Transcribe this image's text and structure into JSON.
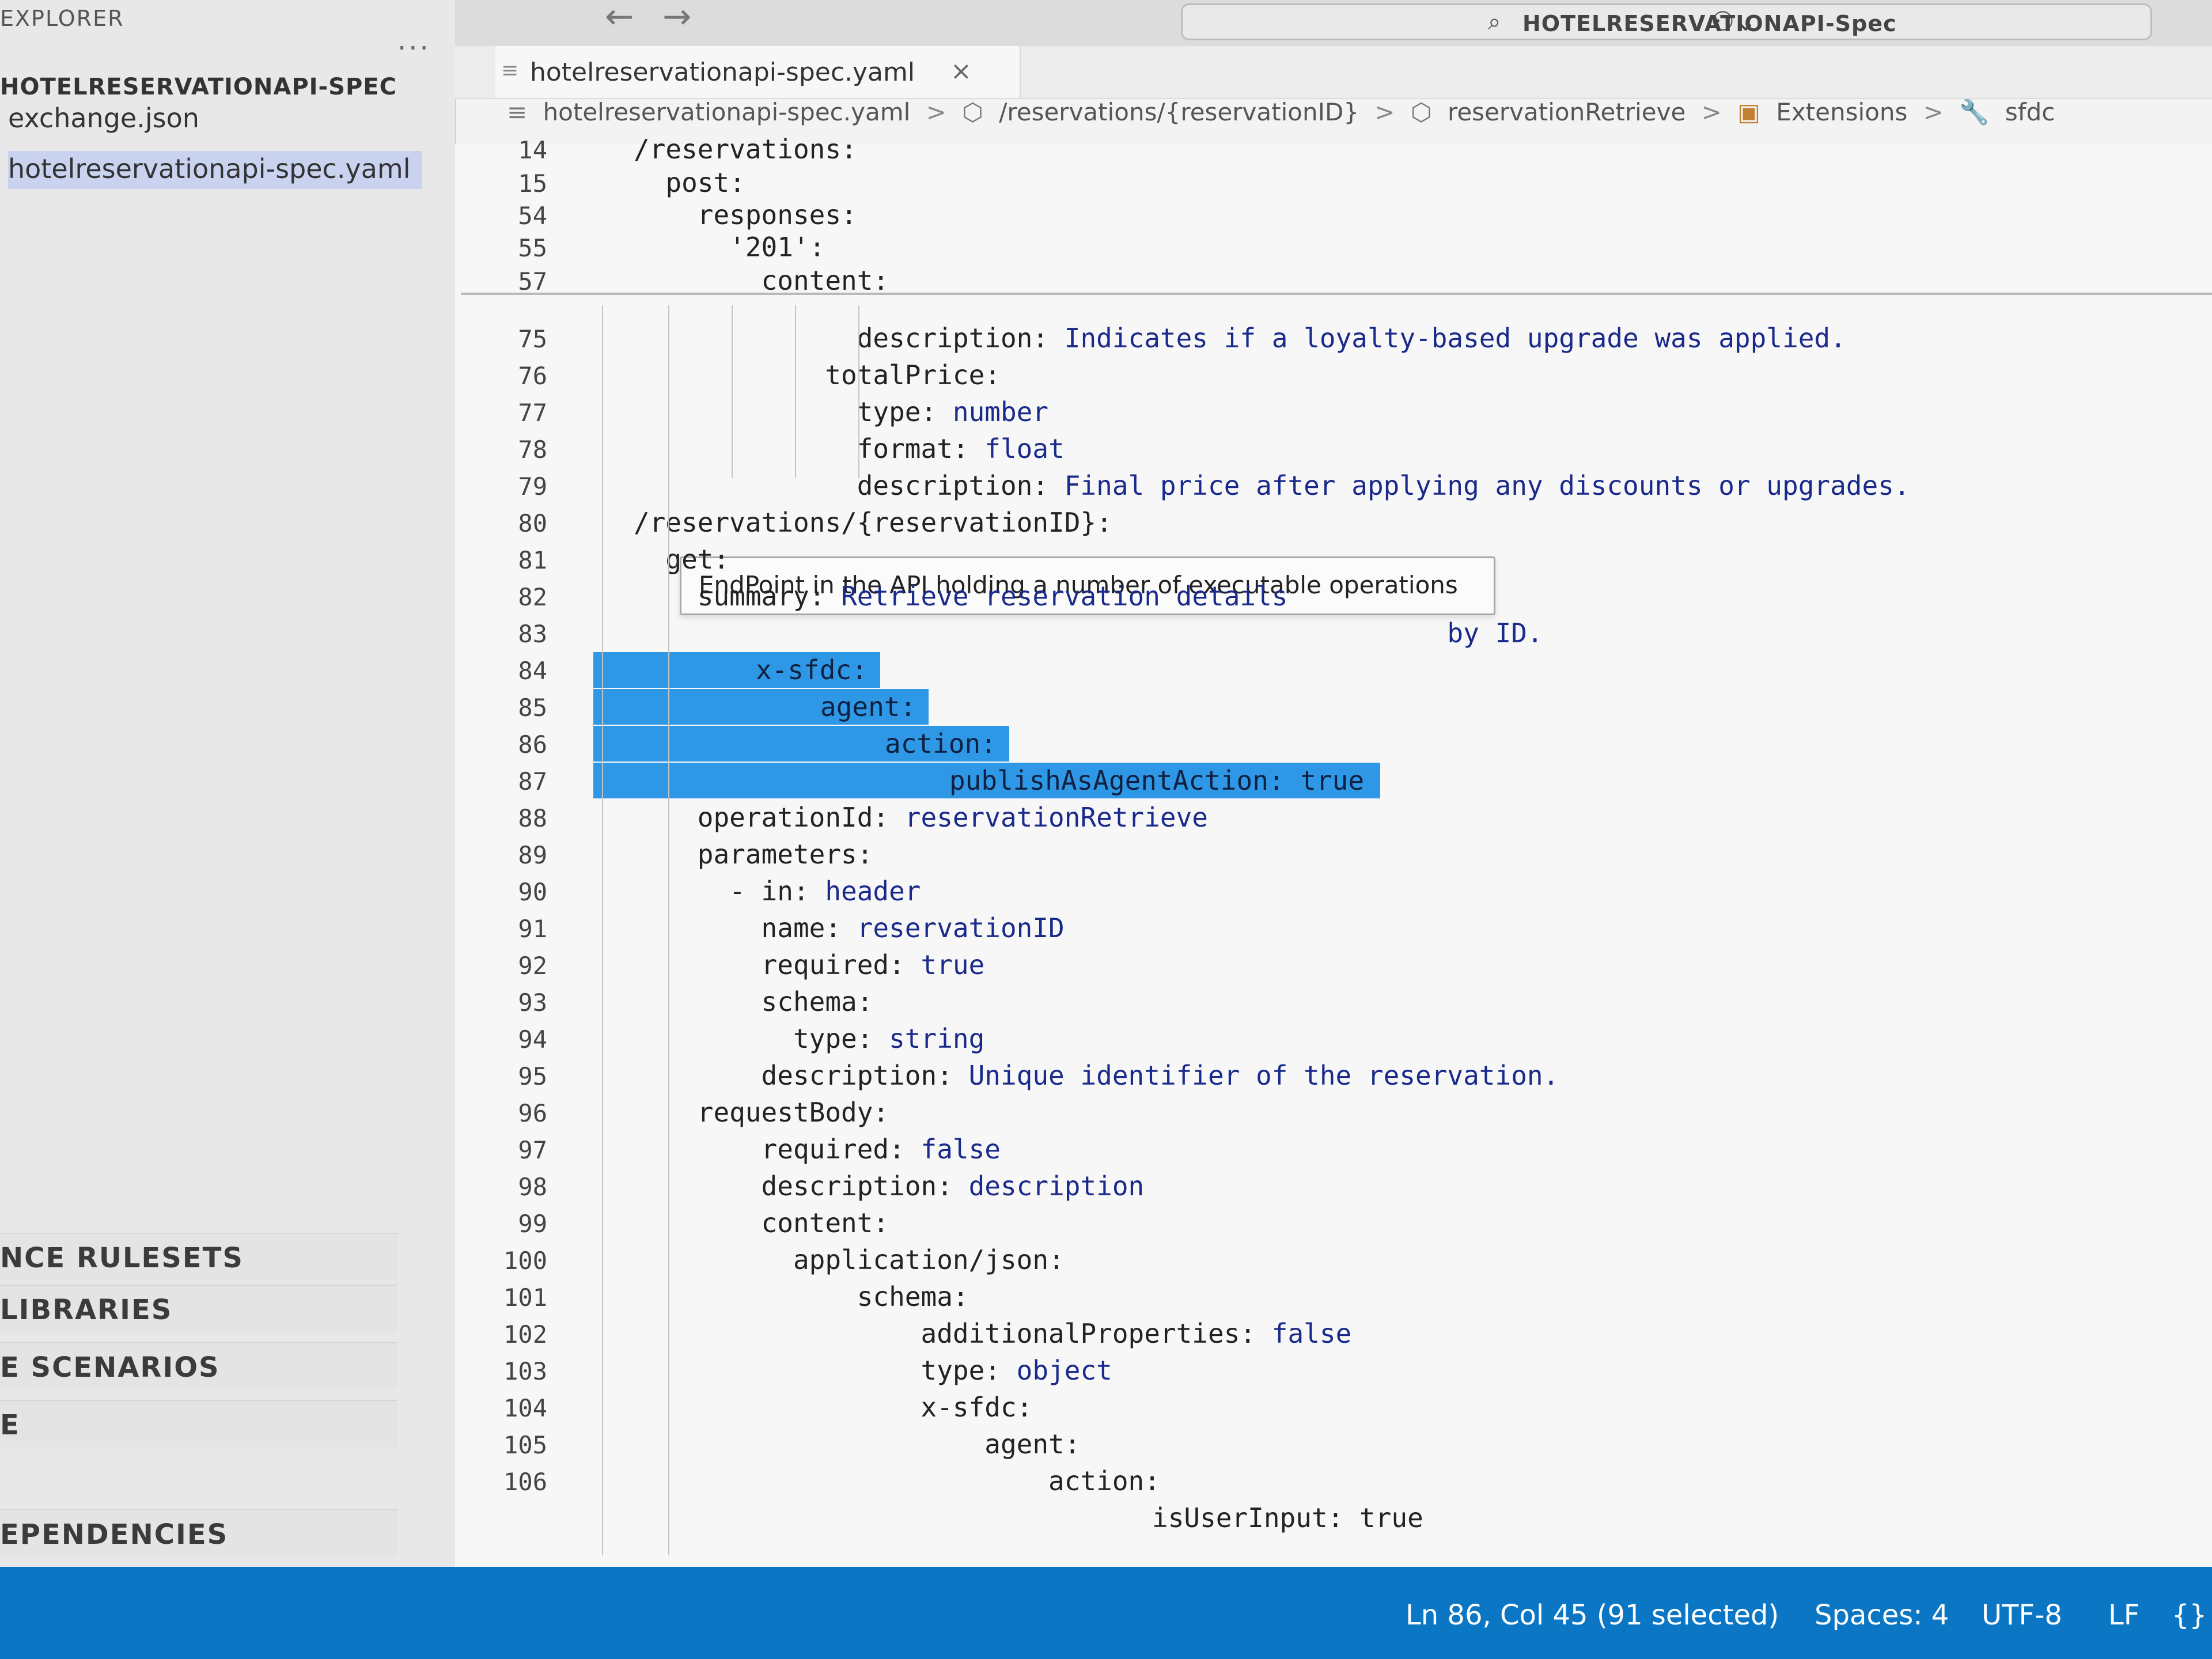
{
  "sidebar": {
    "title": "EXPLORER",
    "more": "···",
    "root": "HOTELRESERVATIONAPI-SPEC",
    "files": [
      "exchange.json",
      "hotelreservationapi-spec.yaml"
    ],
    "sections": [
      "NCE RULESETS",
      "LIBRARIES",
      "E SCENARIOS",
      "E",
      "EPENDENCIES"
    ]
  },
  "titlebar": {
    "back": "←",
    "forward": "→",
    "command_center": "HOTELRESERVATIONAPI-Spec"
  },
  "tab": {
    "label": "hotelreservationapi-spec.yaml",
    "close": "×"
  },
  "breadcrumb": {
    "file": "hotelreservationapi-spec.yaml",
    "path": "/reservations/{reservationID}",
    "operation": "reservationRetrieve",
    "extensions": "Extensions",
    "leaf": "sfdc",
    "sep": ">"
  },
  "right_icons": {
    "hash": "#"
  },
  "tooltip": "EndPoint in the API holding a number of executable operations",
  "code": {
    "sticky": [
      {
        "ln": "14",
        "text": "/reservations:"
      },
      {
        "ln": "15",
        "text": "  post:"
      },
      {
        "ln": "54",
        "text": "    responses:"
      },
      {
        "ln": "55",
        "text": "      '201':"
      },
      {
        "ln": "57",
        "text": "        content:"
      }
    ],
    "lines": [
      {
        "ln": "75",
        "key": "              description:",
        "val": " Indicates if a loyalty-based upgrade was applied."
      },
      {
        "ln": "76",
        "key": "            totalPrice:",
        "val": ""
      },
      {
        "ln": "77",
        "key": "              type:",
        "val": " number"
      },
      {
        "ln": "78",
        "key": "              format:",
        "val": " float"
      },
      {
        "ln": "79",
        "key": "              description:",
        "val": " Final price after applying any discounts or upgrades."
      },
      {
        "ln": "80",
        "key": "/reservations/{reservationID}:",
        "val": ""
      },
      {
        "ln": "81",
        "key": "  get:",
        "val": ""
      },
      {
        "ln": "82",
        "key": "    summary:",
        "val": " Retrieve reservation details"
      },
      {
        "ln": "83",
        "key": "",
        "val": "                                                   by ID."
      },
      {
        "ln": "84",
        "key": "",
        "val": ""
      },
      {
        "ln": "85",
        "key": "",
        "val": ""
      },
      {
        "ln": "86",
        "key": "",
        "val": ""
      },
      {
        "ln": "87",
        "key": "",
        "val": ""
      },
      {
        "ln": "88",
        "key": "    operationId:",
        "val": " reservationRetrieve"
      },
      {
        "ln": "89",
        "key": "    parameters:",
        "val": ""
      },
      {
        "ln": "90",
        "key": "      - in:",
        "val": " header"
      },
      {
        "ln": "91",
        "key": "        name:",
        "val": " reservationID"
      },
      {
        "ln": "92",
        "key": "        required:",
        "val": " true"
      },
      {
        "ln": "93",
        "key": "        schema:",
        "val": ""
      },
      {
        "ln": "94",
        "key": "          type:",
        "val": " string"
      },
      {
        "ln": "95",
        "key": "        description:",
        "val": " Unique identifier of the reservation."
      },
      {
        "ln": "96",
        "key": "    requestBody:",
        "val": ""
      },
      {
        "ln": "97",
        "key": "        required:",
        "val": " false"
      },
      {
        "ln": "98",
        "key": "        description:",
        "val": " description"
      },
      {
        "ln": "99",
        "key": "        content:",
        "val": ""
      },
      {
        "ln": "100",
        "key": "          application/json:",
        "val": ""
      },
      {
        "ln": "101",
        "key": "              schema:",
        "val": ""
      },
      {
        "ln": "102",
        "key": "                  additionalProperties:",
        "val": " false"
      },
      {
        "ln": "103",
        "key": "                  type:",
        "val": " object"
      },
      {
        "ln": "104",
        "key": "                  x-sfdc:",
        "val": ""
      },
      {
        "ln": "105",
        "key": "                      agent:",
        "val": ""
      },
      {
        "ln": "106",
        "key": "                          action:",
        "val": ""
      }
    ],
    "selection": [
      "x-sfdc:",
      "agent:",
      "action:",
      "publishAsAgentAction: true"
    ],
    "last_line": "isUserInput: true"
  },
  "status": {
    "position": "Ln 86, Col 45 (91 selected)",
    "spaces": "Spaces: 4",
    "encoding": "UTF-8",
    "eol": "LF",
    "lang": "{}"
  },
  "colors": {
    "status_bar": "#0b77c4",
    "selection": "#2f98e6",
    "value": "#1a2a8a"
  }
}
